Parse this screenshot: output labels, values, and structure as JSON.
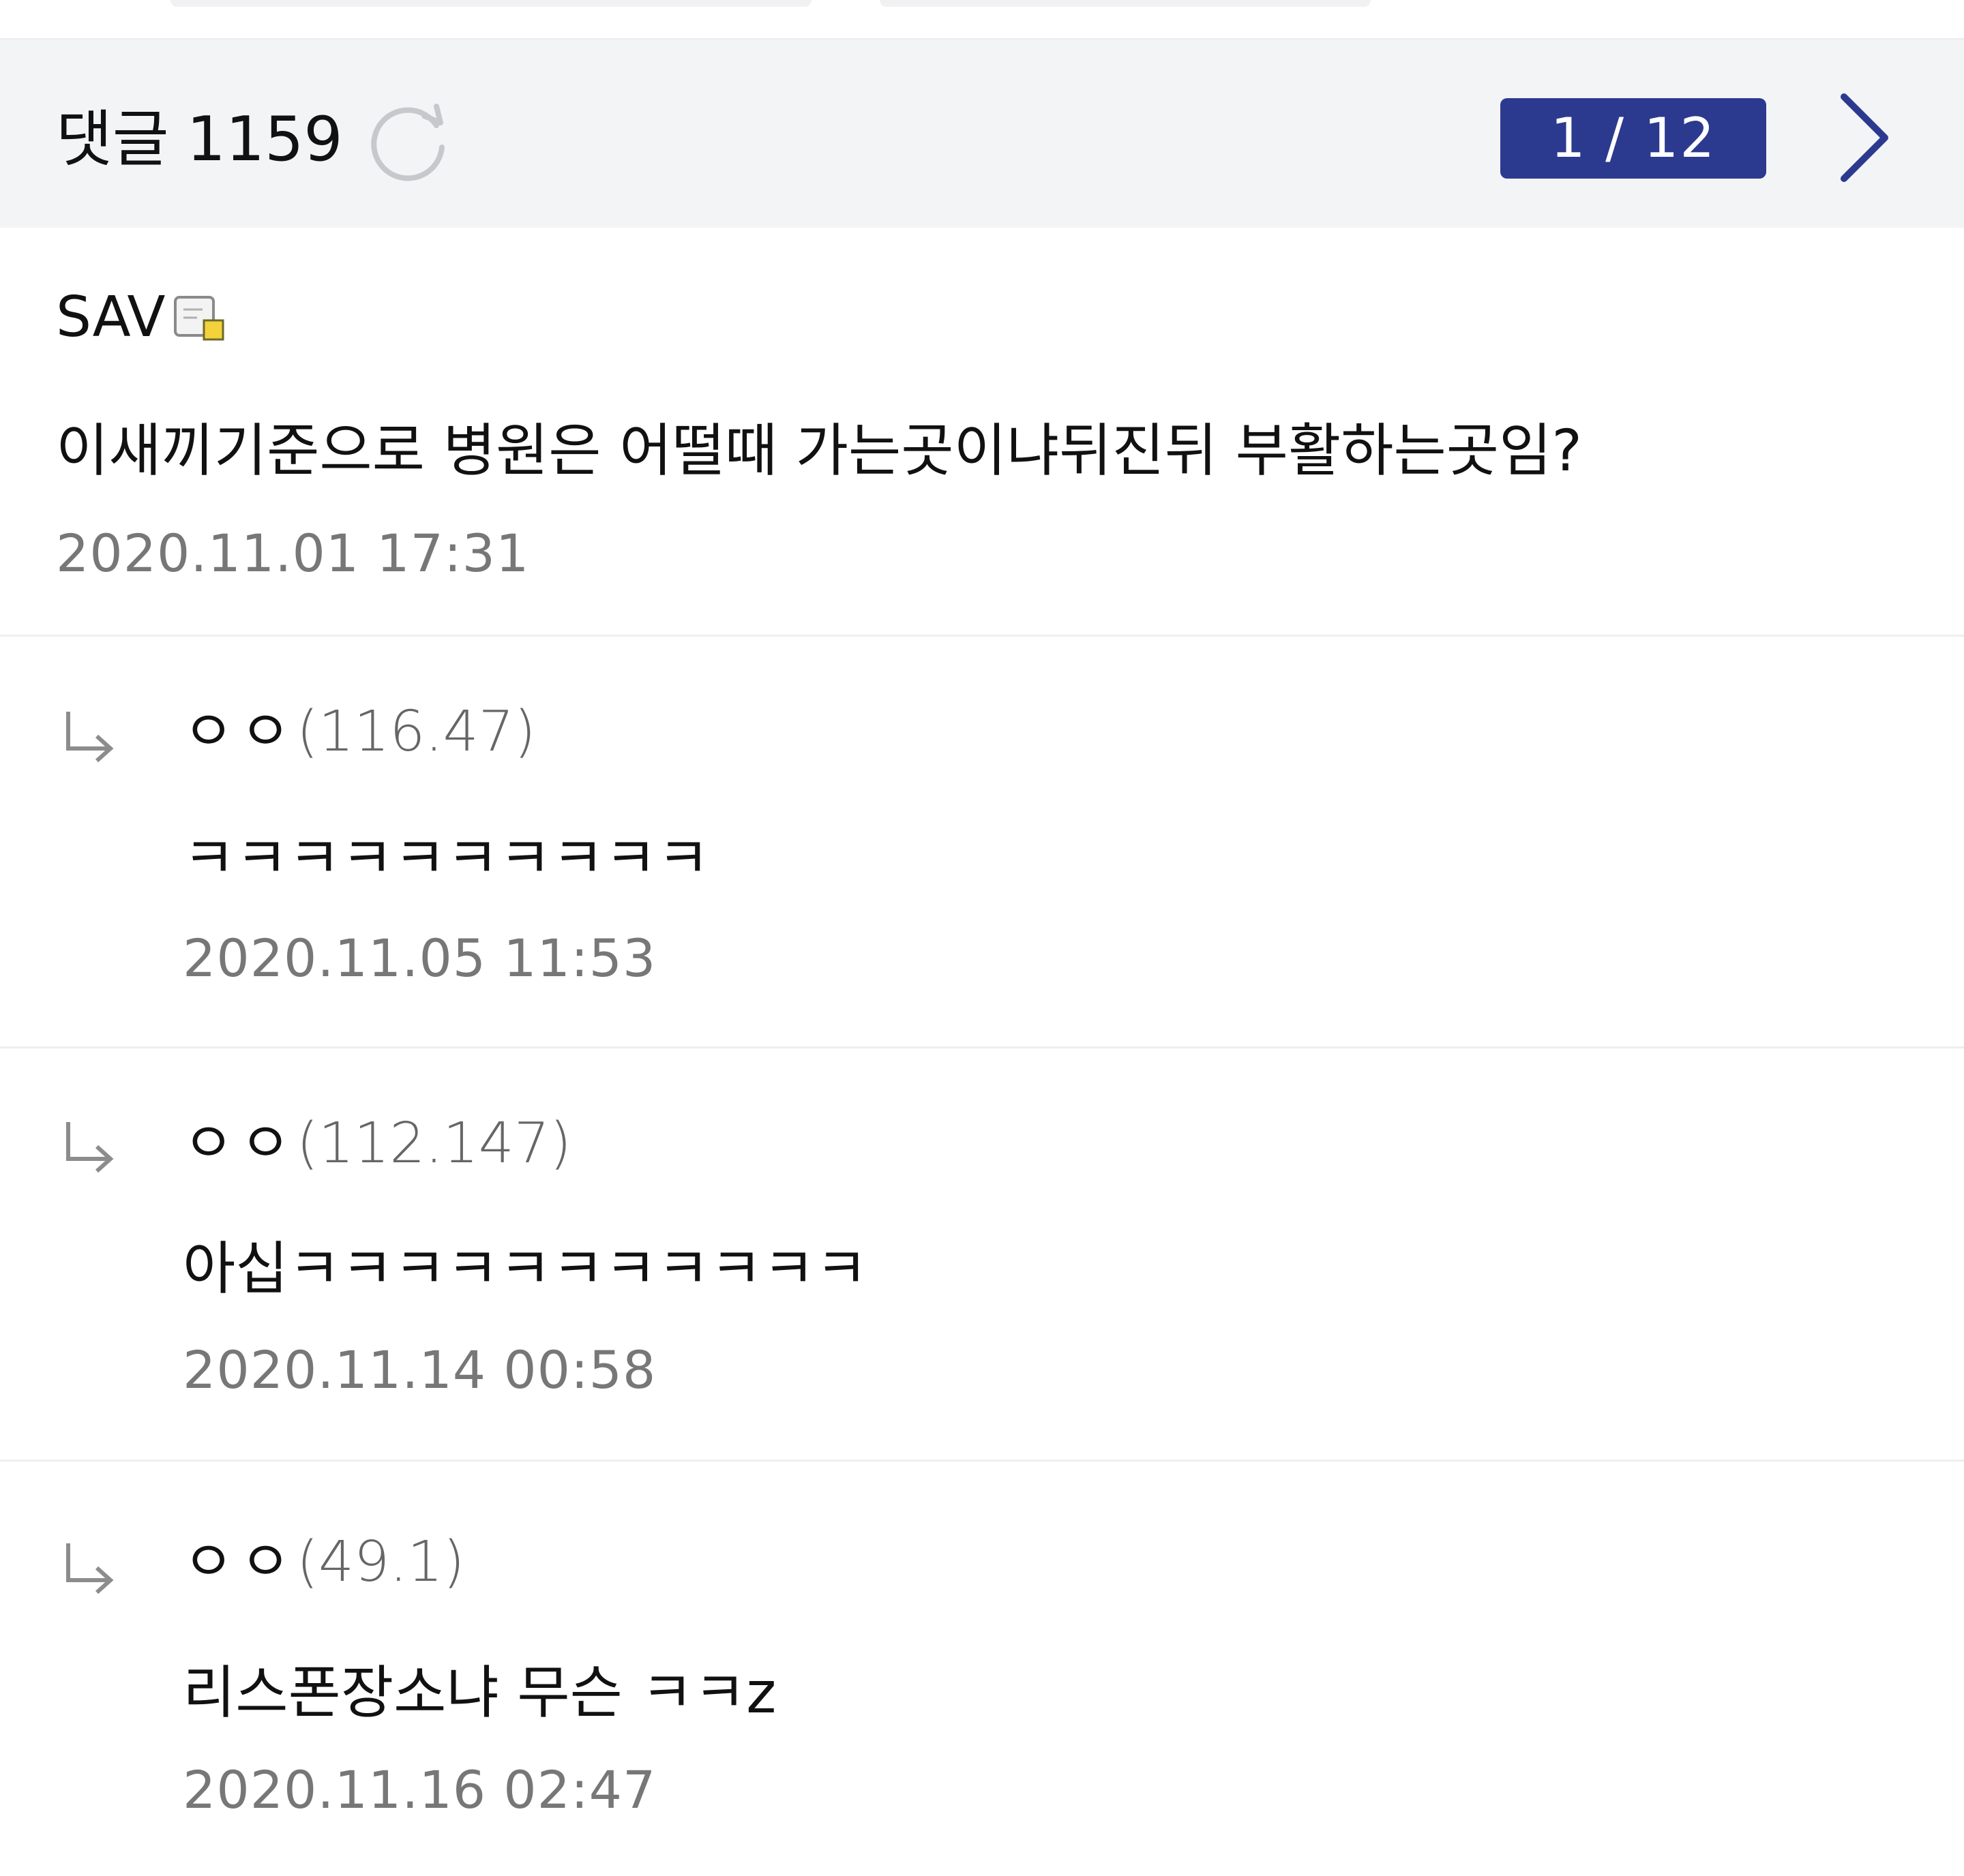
{
  "header": {
    "comment_label": "댓글",
    "comment_count": "1159",
    "page_indicator": "1 / 12"
  },
  "icons": {
    "refresh": "refresh-icon",
    "next": "chevron-right-icon",
    "reply": "reply-arrow-icon",
    "badge": "member-badge-icon"
  },
  "comments": [
    {
      "nickname": "SAV",
      "ip": "",
      "text": "이새끼기준으로 병원은 어떨때 가는곳이냐뒤진뒤 부활하는곳임?",
      "time": "2020.11.01 17:31"
    },
    {
      "nickname": "ㅇㅇ",
      "ip": "(116.47)",
      "text": "ㅋㅋㅋㅋㅋㅋㅋㅋㅋㅋ",
      "time": "2020.11.05 11:53"
    },
    {
      "nickname": "ㅇㅇ",
      "ip": "(112.147)",
      "text": "아십ㅋㅋㅋㅋㅋㅋㅋㅋㅋㅋㅋ",
      "time": "2020.11.14 00:58"
    },
    {
      "nickname": "ㅇㅇ",
      "ip": "(49.1)",
      "text": "리스폰장소냐 무슨 ㅋㅋz",
      "time": "2020.11.16 02:47"
    }
  ]
}
